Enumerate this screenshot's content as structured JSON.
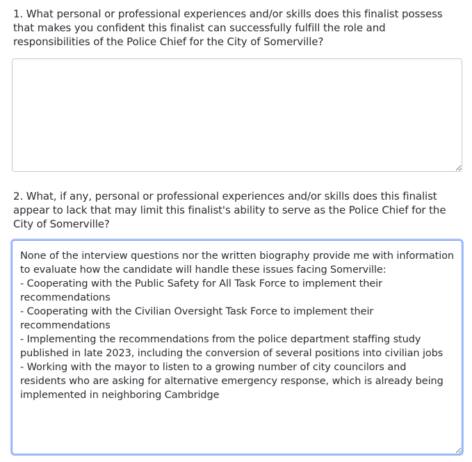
{
  "questions": [
    {
      "label": "1. What personal or professional experiences and/or skills does this finalist possess that makes you confident this finalist can successfully fulfill the role and responsibilities of the Police Chief for the City of Somerville?",
      "answer": ""
    },
    {
      "label": "2. What, if any, personal or professional experiences and/or skills does this finalist appear to lack that may limit this finalist's ability to serve as the Police Chief for the City of Somerville?",
      "answer": "None of the interview questions nor the written biography provide me with information to evaluate how the candidate will handle these issues facing Somerville:\n- Cooperating with the Public Safety for All Task Force to implement their recommendations\n- Cooperating with the Civilian Oversight Task Force to implement their recommendations\n- Implementing the recommendations from the police department staffing study published in late 2023, including the conversion of several positions into civilian jobs\n- Working with the mayor to listen to a growing number of city councilors and residents who are asking for alternative emergency response, which is already being implemented in neighboring Cambridge"
    }
  ],
  "colors": {
    "focus_ring": "#a9c2ff",
    "border": "#c8c8cc",
    "text": "#2b2b33"
  }
}
